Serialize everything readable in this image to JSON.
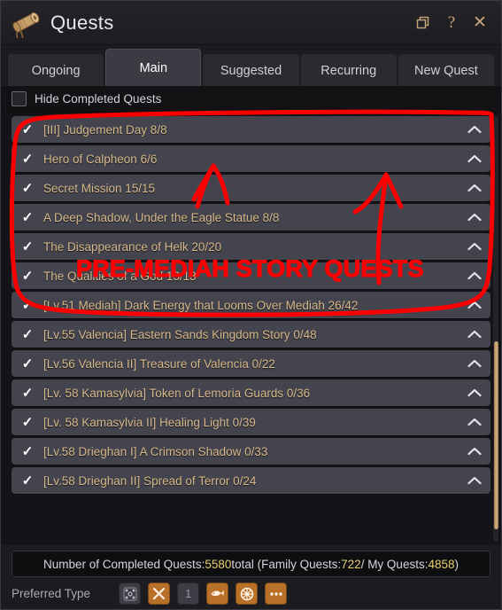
{
  "window": {
    "title": "Quests",
    "icon": "scroll-icon",
    "actions": [
      {
        "name": "window-mode-icon",
        "glyph": "❐"
      },
      {
        "name": "help-icon",
        "glyph": "?"
      },
      {
        "name": "close-icon",
        "glyph": "✕"
      }
    ]
  },
  "tabs": [
    {
      "label": "Ongoing",
      "active": false
    },
    {
      "label": "Main",
      "active": true
    },
    {
      "label": "Suggested",
      "active": false
    },
    {
      "label": "Recurring",
      "active": false
    },
    {
      "label": "New Quest",
      "active": false
    }
  ],
  "filter": {
    "hide_completed_label": "Hide Completed Quests",
    "hide_completed_checked": false
  },
  "quests": [
    {
      "check": "✓",
      "title": "[III] Judgement Day 8/8",
      "chevron": "chevron-up-icon"
    },
    {
      "check": "✓",
      "title": "Hero of Calpheon 6/6",
      "chevron": "chevron-up-icon"
    },
    {
      "check": "✓",
      "title": "Secret Mission 15/15",
      "chevron": "chevron-up-icon"
    },
    {
      "check": "✓",
      "title": "A Deep Shadow, Under the Eagle Statue 8/8",
      "chevron": "chevron-up-icon"
    },
    {
      "check": "✓",
      "title": "The Disappearance of Helk 20/20",
      "chevron": "chevron-up-icon"
    },
    {
      "check": "✓",
      "title": "The Qualities of a God 13/13",
      "chevron": "chevron-up-icon"
    },
    {
      "check": "✓",
      "title": "[Lv.51 Mediah] Dark Energy that Looms Over Mediah 26/42",
      "chevron": "chevron-up-icon"
    },
    {
      "check": "✓",
      "title": "[Lv.55 Valencia] Eastern Sands Kingdom Story 0/48",
      "chevron": "chevron-up-icon"
    },
    {
      "check": "✓",
      "title": "[Lv.56 Valencia II] Treasure of Valencia 0/22",
      "chevron": "chevron-up-icon"
    },
    {
      "check": "✓",
      "title": "[Lv. 58 Kamasylvia] Token of Lemoria Guards 0/36",
      "chevron": "chevron-up-icon"
    },
    {
      "check": "✓",
      "title": "[Lv. 58 Kamasylvia II] Healing Light 0/39",
      "chevron": "chevron-up-icon"
    },
    {
      "check": "✓",
      "title": "[Lv.58 Drieghan I] A Crimson Shadow 0/33",
      "chevron": "chevron-up-icon"
    },
    {
      "check": "✓",
      "title": "[Lv.58 Drieghan II] Spread of Terror 0/24",
      "chevron": "chevron-up-icon"
    }
  ],
  "footer": {
    "summary_prefix": "Number of Completed Quests: ",
    "summary_total": "5580",
    "summary_mid": " total (Family Quests: ",
    "summary_family": "722",
    "summary_sep": " / My Quests: ",
    "summary_my": "4858",
    "summary_suffix": ")",
    "preferred_type_label": "Preferred Type",
    "preferred_icons": [
      {
        "name": "node-grid-icon",
        "glyph": "∷",
        "active": false
      },
      {
        "name": "crossed-swords-icon",
        "glyph": "✖",
        "active": true
      },
      {
        "name": "level-one-icon",
        "glyph": "1",
        "active": false
      },
      {
        "name": "fish-icon",
        "glyph": "➤",
        "active": true
      },
      {
        "name": "wheel-icon",
        "glyph": "✳",
        "active": true
      },
      {
        "name": "more-options-icon",
        "glyph": "•••",
        "active": true
      }
    ]
  },
  "annotation": {
    "text": "PRE-MEDIAH STORY QUESTS",
    "color": "#fb0000"
  }
}
